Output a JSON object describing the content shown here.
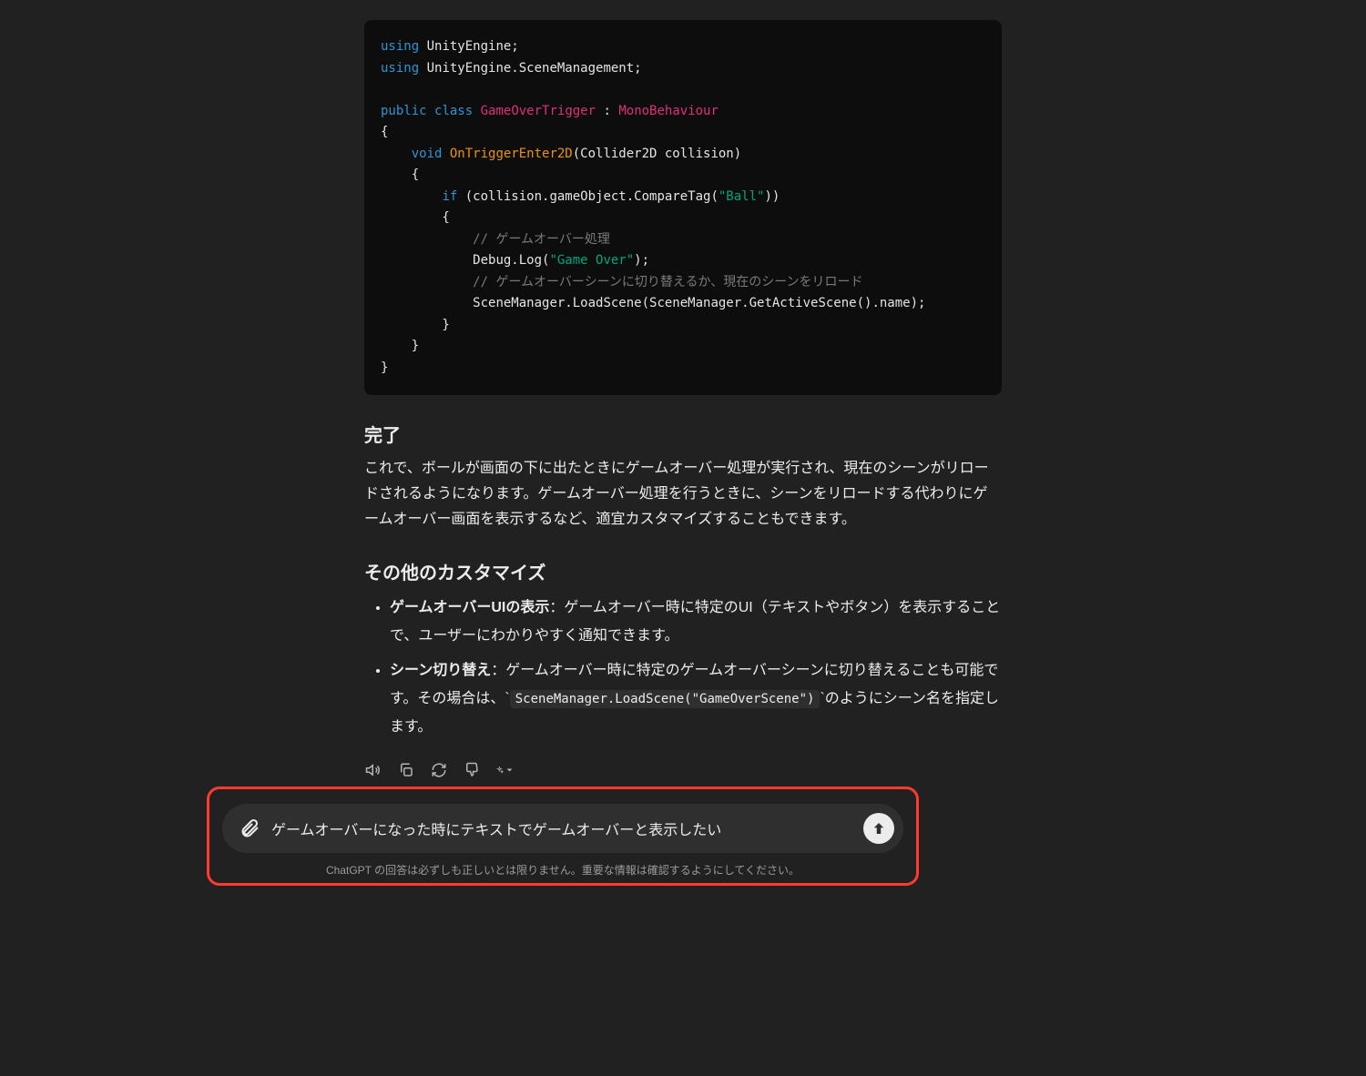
{
  "code": {
    "line1_kw": "using",
    "line1_rest": " UnityEngine;",
    "line2_kw": "using",
    "line2_rest": " UnityEngine.SceneManagement;",
    "line4_public": "public",
    "line4_class": "class",
    "line4_name": "GameOverTrigger",
    "line4_colon": " : ",
    "line4_base": "MonoBehaviour",
    "line5": "{",
    "line6_pad": "    ",
    "line6_void": "void",
    "line6_method": " OnTriggerEnter2D",
    "line6_params": "(Collider2D collision)",
    "line7": "    {",
    "line8_pad": "        ",
    "line8_if": "if",
    "line8_rest_a": " (collision.gameObject.CompareTag(",
    "line8_str": "\"Ball\"",
    "line8_rest_b": "))",
    "line9": "        {",
    "line10_pad": "            ",
    "line10_cmt": "// ゲームオーバー処理",
    "line11_pad": "            ",
    "line11_a": "Debug.Log(",
    "line11_str": "\"Game Over\"",
    "line11_b": ");",
    "line12_pad": "            ",
    "line12_cmt": "// ゲームオーバーシーンに切り替えるか、現在のシーンをリロード",
    "line13_pad": "            ",
    "line13": "SceneManager.LoadScene(SceneManager.GetActiveScene().name);",
    "line14": "        }",
    "line15": "    }",
    "line16": "}"
  },
  "sections": {
    "done_heading": "完了",
    "done_body": "これで、ボールが画面の下に出たときにゲームオーバー処理が実行され、現在のシーンがリロードされるようになります。ゲームオーバー処理を行うときに、シーンをリロードする代わりにゲームオーバー画面を表示するなど、適宜カスタマイズすることもできます。",
    "other_heading": "その他のカスタマイズ",
    "bullets": [
      {
        "bold": "ゲームオーバーUIの表示",
        "rest": "：ゲームオーバー時に特定のUI（テキストやボタン）を表示することで、ユーザーにわかりやすく通知できます。"
      },
      {
        "bold": "シーン切り替え",
        "rest_a": "：ゲームオーバー時に特定のゲームオーバーシーンに切り替えることも可能です。その場合は、",
        "code": "SceneManager.LoadScene(\"GameOverScene\")",
        "rest_b": "のようにシーン名を指定します。"
      }
    ]
  },
  "input": {
    "text": "ゲームオーバーになった時にテキストでゲームオーバーと表示したい",
    "disclaimer": "ChatGPT の回答は必ずしも正しいとは限りません。重要な情報は確認するようにしてください。"
  }
}
